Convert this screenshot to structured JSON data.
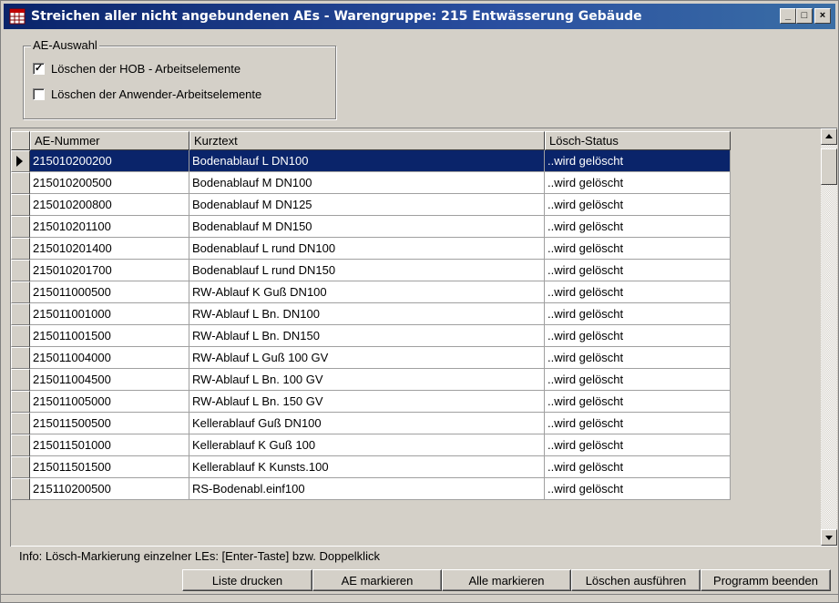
{
  "window": {
    "title": "Streichen aller nicht angebundenen AEs - Warengruppe: 215  Entwässerung Gebäude",
    "controls": {
      "minimize": "_",
      "maximize": "□",
      "close": "×"
    }
  },
  "group": {
    "legend": "AE-Auswahl",
    "options": [
      {
        "label": "Löschen der HOB - Arbeitselemente",
        "checked": true,
        "mark": "✓"
      },
      {
        "label": "Löschen der Anwender-Arbeitselemente",
        "checked": false,
        "mark": ""
      }
    ]
  },
  "grid": {
    "columns": [
      "AE-Nummer",
      "Kurztext",
      "Lösch-Status"
    ],
    "selected_index": 0,
    "rows": [
      {
        "nummer": "215010200200",
        "kurztext": "Bodenablauf L DN100",
        "status": "..wird gelöscht"
      },
      {
        "nummer": "215010200500",
        "kurztext": "Bodenablauf M DN100",
        "status": "..wird gelöscht"
      },
      {
        "nummer": "215010200800",
        "kurztext": "Bodenablauf M DN125",
        "status": "..wird gelöscht"
      },
      {
        "nummer": "215010201100",
        "kurztext": "Bodenablauf M DN150",
        "status": "..wird gelöscht"
      },
      {
        "nummer": "215010201400",
        "kurztext": "Bodenablauf L rund DN100",
        "status": "..wird gelöscht"
      },
      {
        "nummer": "215010201700",
        "kurztext": "Bodenablauf L rund DN150",
        "status": "..wird gelöscht"
      },
      {
        "nummer": "215011000500",
        "kurztext": "RW-Ablauf K Guß DN100",
        "status": "..wird gelöscht"
      },
      {
        "nummer": "215011001000",
        "kurztext": "RW-Ablauf L Bn. DN100",
        "status": "..wird gelöscht"
      },
      {
        "nummer": "215011001500",
        "kurztext": "RW-Ablauf L Bn. DN150",
        "status": "..wird gelöscht"
      },
      {
        "nummer": "215011004000",
        "kurztext": "RW-Ablauf L Guß 100 GV",
        "status": "..wird gelöscht"
      },
      {
        "nummer": "215011004500",
        "kurztext": "RW-Ablauf L Bn. 100 GV",
        "status": "..wird gelöscht"
      },
      {
        "nummer": "215011005000",
        "kurztext": "RW-Ablauf L Bn. 150 GV",
        "status": "..wird gelöscht"
      },
      {
        "nummer": "215011500500",
        "kurztext": "Kellerablauf Guß DN100",
        "status": "..wird gelöscht"
      },
      {
        "nummer": "215011501000",
        "kurztext": "Kellerablauf K Guß 100",
        "status": "..wird gelöscht"
      },
      {
        "nummer": "215011501500",
        "kurztext": "Kellerablauf K Kunsts.100",
        "status": "..wird gelöscht"
      },
      {
        "nummer": "215110200500",
        "kurztext": "RS-Bodenabl.einf100",
        "status": "..wird gelöscht"
      }
    ]
  },
  "info": "Info:  Lösch-Markierung einzelner LEs: [Enter-Taste] bzw. Doppelklick",
  "buttons": [
    {
      "name": "print-list-button",
      "label": "Liste drucken"
    },
    {
      "name": "mark-ae-button",
      "label": "AE markieren"
    },
    {
      "name": "mark-all-button",
      "label": "Alle markieren"
    },
    {
      "name": "execute-delete-button",
      "label": "Löschen ausführen"
    },
    {
      "name": "exit-program-button",
      "label": "Programm beenden"
    }
  ],
  "colors": {
    "title_bar": "#0a246a",
    "selection": "#0a246a",
    "face": "#d4d0c8"
  },
  "icons": {
    "app": "table-icon"
  }
}
